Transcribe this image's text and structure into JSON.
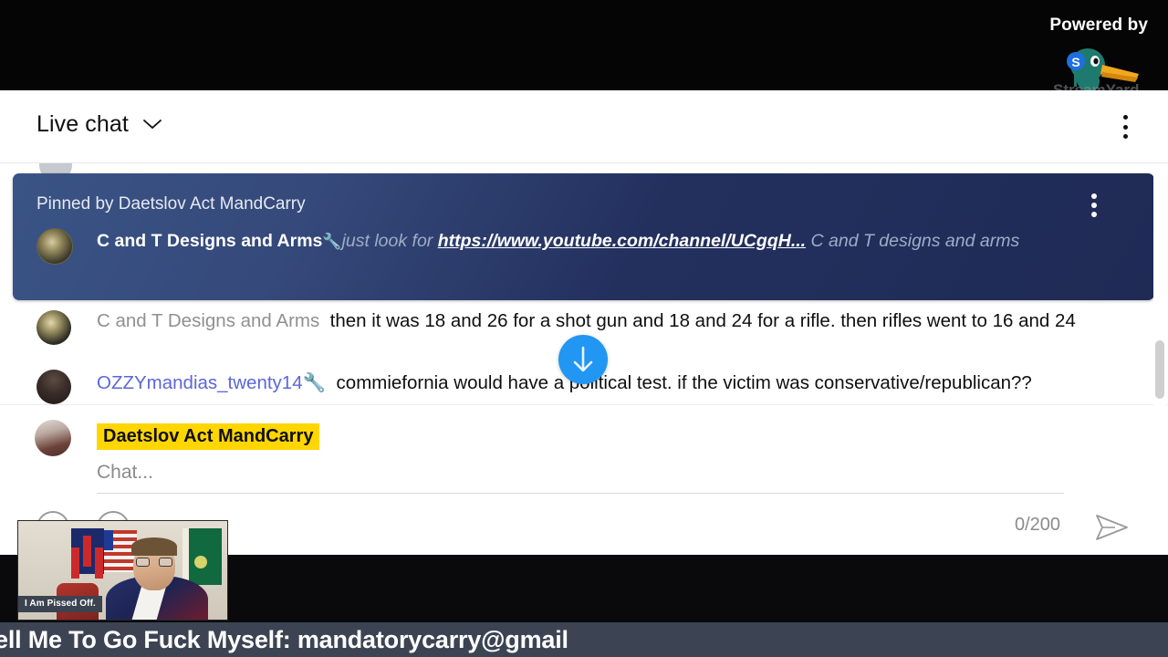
{
  "branding": {
    "powered_by": "Powered by",
    "logo_name": "streamyard-duck-logo",
    "wordmark": "StreamYard"
  },
  "header": {
    "title": "Live chat",
    "chevron_icon": "chevron-down-icon",
    "menu_icon": "more-vertical-icon"
  },
  "pinned": {
    "label": "Pinned by Daetslov Act MandCarry",
    "author": "C and T Designs and Arms",
    "badge_icon": "wrench-icon",
    "badge_glyph": "🔧",
    "message_pre": "just look for ",
    "link": "https://www.youtube.com/channel/UCgqH...",
    "message_post": " C and T designs and arms",
    "menu_icon": "more-vertical-icon"
  },
  "messages": [
    {
      "author": "C and T Designs and Arms",
      "author_style": "grey",
      "badge_glyph": "",
      "text": "then it was 18 and 26 for a shot gun and 18 and 24 for a rifle. then rifles went to 16 and 24"
    },
    {
      "author": "OZZYmandias_twenty14",
      "author_style": "mod",
      "badge_glyph": "🔧",
      "text": "commiefornia would have a political test. if the victim was conservative/republican??"
    }
  ],
  "scroll_button": {
    "icon": "arrow-down-icon",
    "color": "#2196f3"
  },
  "composer": {
    "user_name": "Daetslov Act MandCarry",
    "user_name_highlight": "#ffd600",
    "input_value": "",
    "input_placeholder": "Chat...",
    "char_count": "0/200",
    "send_icon": "send-icon",
    "emoji_button_icon": "emoji-icon",
    "money_button_icon": "super-chat-icon"
  },
  "webcam": {
    "caption": "I Am Pissed Off."
  },
  "banner": {
    "text": "ell Me To Go Fuck Myself: mandatorycarry@gmail",
    "background": "#3c4453"
  }
}
